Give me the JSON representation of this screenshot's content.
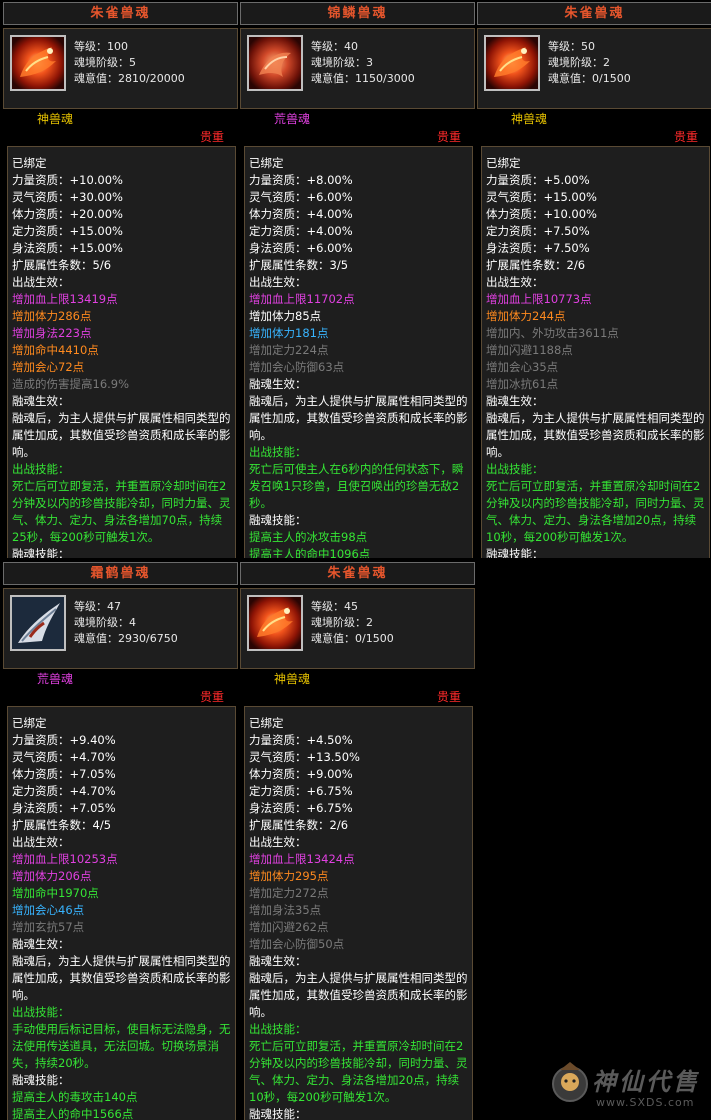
{
  "labels": {
    "level": "等级：",
    "tier": "魂境阶级：",
    "will": "魂意值：",
    "rare": "贵重",
    "bound": "已绑定",
    "str": "力量资质：",
    "spi": "灵气资质：",
    "con": "体力资质：",
    "foc": "定力资质：",
    "agi": "身法资质：",
    "ext": "扩展属性条数：",
    "battle": "出战生效：",
    "fusion": "融魂生效：",
    "fusion_desc": "融魂后，为主人提供与扩展属性相同类型的属性加成，其数值受珍兽资质和成长率的影响。",
    "battle_skill": "出战技能：",
    "fusion_skill": "融魂技能："
  },
  "cards": [
    {
      "title": "朱雀兽魂",
      "icon": "vermilion-bird-icon",
      "level": "100",
      "tier": "5",
      "will": "2810/20000",
      "kind": "神兽魂",
      "kind_color": "#e6c200",
      "str": "+10.00%",
      "spi": "+30.00%",
      "con": "+20.00%",
      "foc": "+15.00%",
      "agi": "+15.00%",
      "ext": "5/6",
      "effects": [
        {
          "text": "增加血上限13419点",
          "color": "#e040e0"
        },
        {
          "text": "增加体力286点",
          "color": "#ff8a1e"
        },
        {
          "text": "增加身法223点",
          "color": "#e040e0"
        },
        {
          "text": "增加命中4410点",
          "color": "#ff8a1e"
        },
        {
          "text": "增加会心72点",
          "color": "#ff8a1e"
        },
        {
          "text": "造成的伤害提高16.9%",
          "color": "#7a7a7a"
        }
      ],
      "skill": "死亡后可立即复活，并重置原冷却时间在2分钟及以内的珍兽技能冷却，同时力量、灵气、体力、定力、身法各增加70点，持续25秒，每200秒可触发1次。",
      "fusion_skills": []
    },
    {
      "title": "锦鳞兽魂",
      "icon": "brocade-scale-icon",
      "level": "40",
      "tier": "3",
      "will": "1150/3000",
      "kind": "荒兽魂",
      "kind_color": "#e040e0",
      "str": "+8.00%",
      "spi": "+6.00%",
      "con": "+4.00%",
      "foc": "+4.00%",
      "agi": "+6.00%",
      "ext": "3/5",
      "effects": [
        {
          "text": "增加血上限11702点",
          "color": "#e040e0"
        },
        {
          "text": "增加体力85点",
          "color": "#ffffff"
        },
        {
          "text": "增加体力181点",
          "color": "#38b4ff"
        },
        {
          "text": "增加定力224点",
          "color": "#7a7a7a"
        },
        {
          "text": "增加会心防御63点",
          "color": "#7a7a7a"
        }
      ],
      "skill": "死亡后可使主人在6秒内的任何状态下，瞬发召唤1只珍兽，且使召唤出的珍兽无敌2秒。",
      "fusion_skills": [
        "提高主人的冰攻击98点",
        "提高主人的命中1096点"
      ]
    },
    {
      "title": "朱雀兽魂",
      "icon": "vermilion-bird-icon",
      "level": "50",
      "tier": "2",
      "will": "0/1500",
      "kind": "神兽魂",
      "kind_color": "#e6c200",
      "str": "+5.00%",
      "spi": "+15.00%",
      "con": "+10.00%",
      "foc": "+7.50%",
      "agi": "+7.50%",
      "ext": "2/6",
      "effects": [
        {
          "text": "增加血上限10773点",
          "color": "#e040e0"
        },
        {
          "text": "增加体力244点",
          "color": "#ff8a1e"
        },
        {
          "text": "增加内、外功攻击3611点",
          "color": "#7a7a7a"
        },
        {
          "text": "增加闪避1188点",
          "color": "#7a7a7a"
        },
        {
          "text": "增加会心35点",
          "color": "#7a7a7a"
        },
        {
          "text": "增加冰抗61点",
          "color": "#7a7a7a"
        }
      ],
      "skill": "死亡后可立即复活，并重置原冷却时间在2分钟及以内的珍兽技能冷却，同时力量、灵气、体力、定力、身法各增加20点，持续10秒，每200秒可触发1次。",
      "fusion_skills": []
    },
    {
      "title": "霜鹤兽魂",
      "icon": "frost-crane-icon",
      "level": "47",
      "tier": "4",
      "will": "2930/6750",
      "kind": "荒兽魂",
      "kind_color": "#e040e0",
      "str": "+9.40%",
      "spi": "+4.70%",
      "con": "+7.05%",
      "foc": "+4.70%",
      "agi": "+7.05%",
      "ext": "4/5",
      "effects": [
        {
          "text": "增加血上限10253点",
          "color": "#e040e0"
        },
        {
          "text": "增加体力206点",
          "color": "#e040e0"
        },
        {
          "text": "增加命中1970点",
          "color": "#35e535"
        },
        {
          "text": "增加会心46点",
          "color": "#38b4ff"
        },
        {
          "text": "增加玄抗57点",
          "color": "#7a7a7a"
        }
      ],
      "skill": "手动使用后标记目标，使目标无法隐身，无法使用传送道具，无法回城。切换场景消失，持续20秒。",
      "fusion_skills": [
        "提高主人的毒攻击140点",
        "提高主人的命中1566点"
      ]
    },
    {
      "title": "朱雀兽魂",
      "icon": "vermilion-bird-icon",
      "level": "45",
      "tier": "2",
      "will": "0/1500",
      "kind": "神兽魂",
      "kind_color": "#e6c200",
      "str": "+4.50%",
      "spi": "+13.50%",
      "con": "+9.00%",
      "foc": "+6.75%",
      "agi": "+6.75%",
      "ext": "2/6",
      "effects": [
        {
          "text": "增加血上限13424点",
          "color": "#e040e0"
        },
        {
          "text": "增加体力295点",
          "color": "#ff8a1e"
        },
        {
          "text": "增加定力272点",
          "color": "#7a7a7a"
        },
        {
          "text": "增加身法35点",
          "color": "#7a7a7a"
        },
        {
          "text": "增加闪避262点",
          "color": "#7a7a7a"
        },
        {
          "text": "增加会心防御50点",
          "color": "#7a7a7a"
        }
      ],
      "skill": "死亡后可立即复活，并重置原冷却时间在2分钟及以内的珍兽技能冷却，同时力量、灵气、体力、定力、身法各增加20点，持续10秒，每200秒可触发1次。",
      "fusion_skills": []
    }
  ],
  "watermark": {
    "name": "神仙代售",
    "url": "www.SXDS.com"
  }
}
